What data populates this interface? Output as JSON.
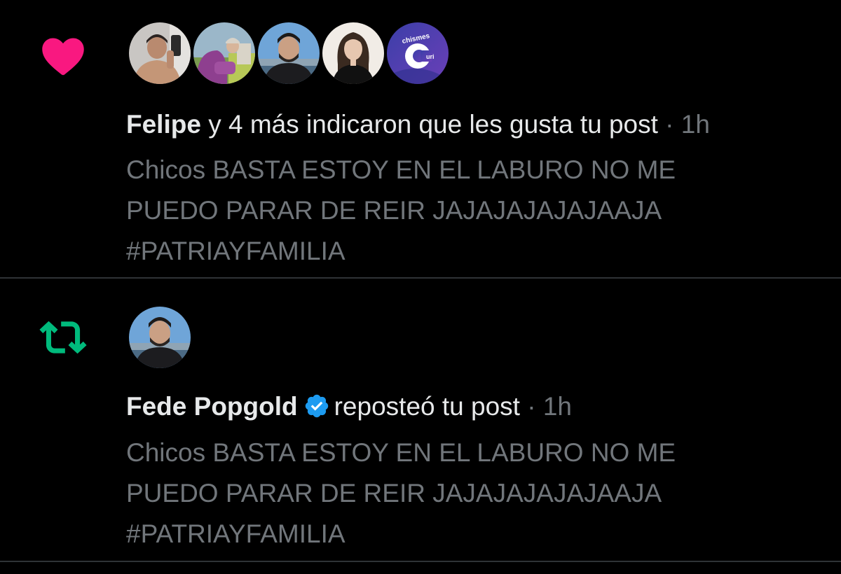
{
  "like_notification": {
    "icon": "heart-icon",
    "icon_color": "#f91880",
    "avatars": [
      {
        "name": "avatar-felipe"
      },
      {
        "name": "avatar-user-2"
      },
      {
        "name": "avatar-user-3"
      },
      {
        "name": "avatar-user-4"
      },
      {
        "name": "avatar-chismes-curi",
        "label_top": "chismes",
        "label_letter": "C",
        "label_small": "uri"
      }
    ],
    "actor": "Felipe",
    "action": " y 4 más indicaron que les gusta tu post",
    "separator": " · ",
    "time": "1h",
    "post_lines": [
      "Chicos BASTA ESTOY EN EL LABURO NO ME",
      "PUEDO PARAR DE REIR JAJAJAJAJAJAAJA",
      "#PATRIAYFAMILIA"
    ]
  },
  "repost_notification": {
    "icon": "repost-icon",
    "icon_color": "#00ba7c",
    "avatars": [
      {
        "name": "avatar-fede-popgold"
      }
    ],
    "actor": "Fede Popgold",
    "verified": true,
    "verified_color": "#1d9bf0",
    "action": "reposteó tu post",
    "separator": " · ",
    "time": "1h",
    "post_lines": [
      "Chicos BASTA ESTOY EN EL LABURO NO ME",
      "PUEDO PARAR DE REIR JAJAJAJAJAJAAJA",
      "#PATRIAYFAMILIA"
    ]
  }
}
